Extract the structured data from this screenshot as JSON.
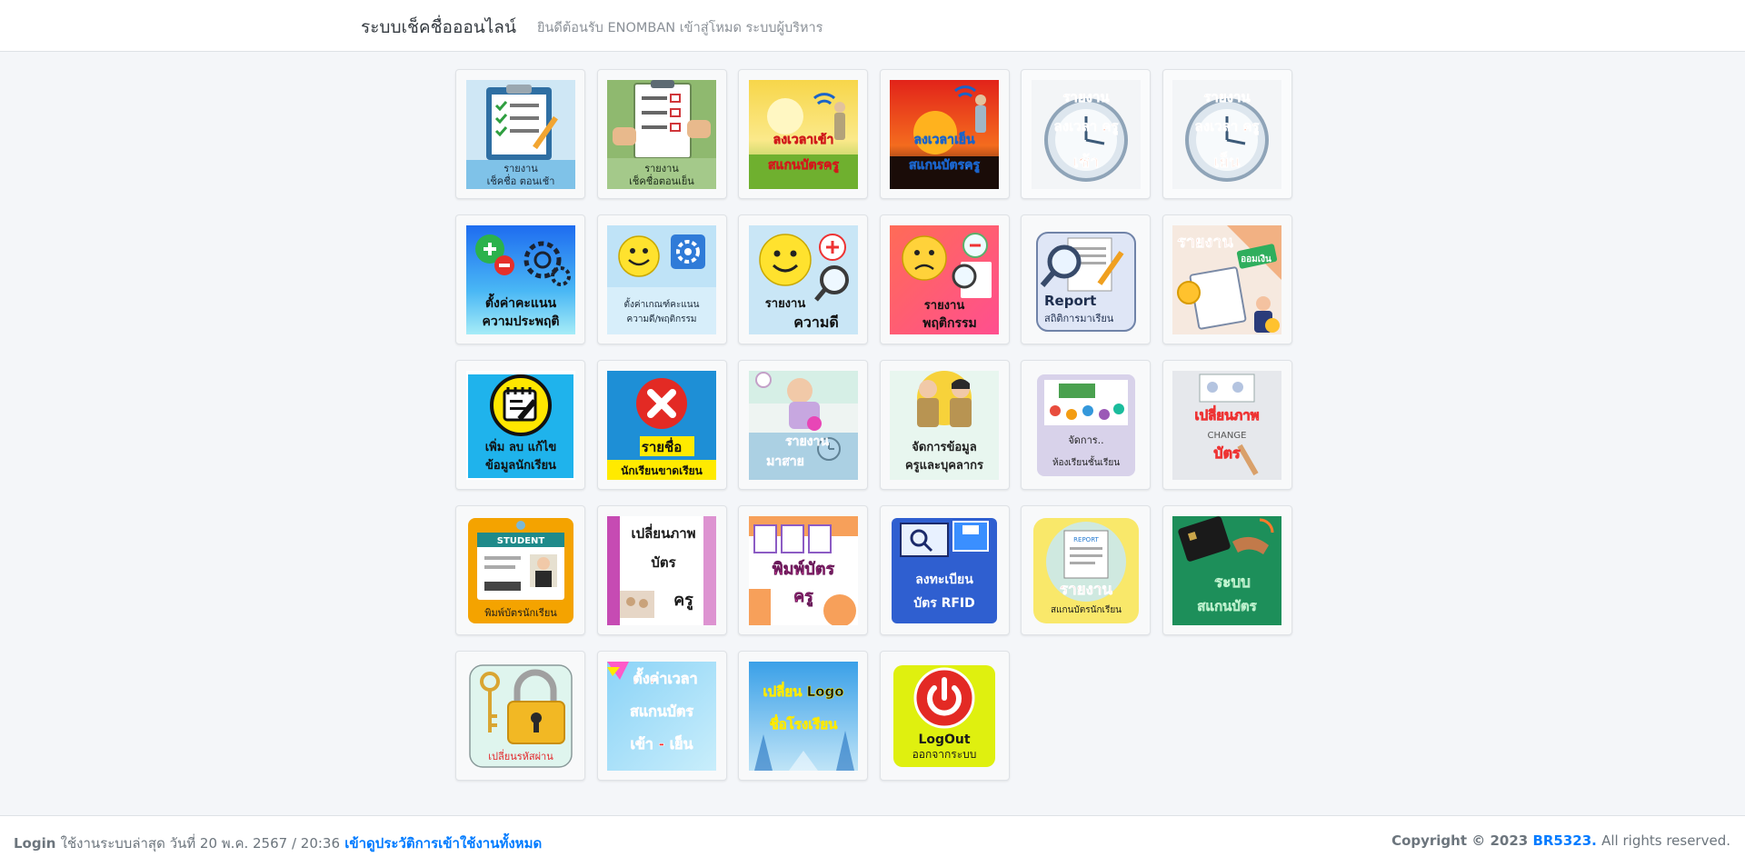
{
  "header": {
    "brand": "ระบบเช็คชื่อออนไลน์",
    "welcome": "ยินดีต้อนรับ ENOMBAN เข้าสู่โหมด ระบบผู้บริหาร"
  },
  "tiles": [
    {
      "icon": "clipboard-checklist-icon",
      "lines": [
        "รายงาน",
        "เช็คชื่อ ตอนเช้า"
      ]
    },
    {
      "icon": "clipboard-checklist-icon",
      "lines": [
        "รายงาน",
        "เช็คชื่อตอนเย็น"
      ]
    },
    {
      "icon": "morning-sun-teacher-icon",
      "lines": [
        "ลงเวลาเข้า",
        "สแกนบัตรครู"
      ]
    },
    {
      "icon": "sunset-teacher-icon",
      "lines": [
        "ลงเวลาเย็น",
        "สแกนบัตรครู"
      ]
    },
    {
      "icon": "clock-report-icon",
      "lines": [
        "รายงาน",
        "ลงเวลา ครู",
        "เช้า"
      ]
    },
    {
      "icon": "clock-report-icon",
      "lines": [
        "รายงาน",
        "ลงเวลา ครู",
        "เย็น"
      ]
    },
    {
      "icon": "gear-plus-minus-icon",
      "lines": [
        "ตั้งค่าคะแนน",
        "ความประพฤติ"
      ]
    },
    {
      "icon": "smiley-gear-icon",
      "lines": [
        "ตั้งค่าเกณฑ์คะแนน",
        "ความดี/พฤติกรรม"
      ]
    },
    {
      "icon": "smiley-magnifier-icon",
      "lines": [
        "รายงาน",
        "ความดี"
      ]
    },
    {
      "icon": "sad-face-magnifier-icon",
      "lines": [
        "รายงาน",
        "พฤติกรรม"
      ]
    },
    {
      "icon": "magnifier-report-icon",
      "lines": [
        "Report",
        "สถิติการมาเรียน"
      ]
    },
    {
      "icon": "money-report-icon",
      "lines": [
        "รายงาน",
        "ออมเงิน"
      ]
    },
    {
      "icon": "notepad-edit-icon",
      "lines": [
        "เพิ่ม ลบ แก้ไข",
        "ข้อมูลนักเรียน"
      ]
    },
    {
      "icon": "red-x-icon",
      "lines": [
        "รายชื่อ",
        "นักเรียนขาดเรียน"
      ]
    },
    {
      "icon": "late-student-icon",
      "lines": [
        "รายงาน",
        "มาสาย"
      ]
    },
    {
      "icon": "teachers-icon",
      "lines": [
        "จัดการข้อมูล",
        "ครูและบุคลากร"
      ]
    },
    {
      "icon": "classroom-icon",
      "lines": [
        "จัดการ..",
        "ห้องเรียนชั้นเรียน"
      ]
    },
    {
      "icon": "change-card-photo-icon",
      "lines": [
        "เปลี่ยนภาพ",
        "CHANGE",
        "บัตร"
      ]
    },
    {
      "icon": "student-card-icon",
      "lines": [
        "STUDENT",
        "พิมพ์บัตรนักเรียน"
      ]
    },
    {
      "icon": "teacher-card-photo-icon",
      "lines": [
        "เปลี่ยนภาพ",
        "บัตร",
        "ครู"
      ]
    },
    {
      "icon": "print-teacher-card-icon",
      "lines": [
        "พิมพ์บัตร",
        "ครู"
      ]
    },
    {
      "icon": "rfid-register-icon",
      "lines": [
        "ลงทะเบียน",
        "บัตร RFID"
      ]
    },
    {
      "icon": "scan-report-icon",
      "lines": [
        "REPORT",
        "รายงาน",
        "สแกนบัตรนักเรียน"
      ]
    },
    {
      "icon": "card-scan-system-icon",
      "lines": [
        "ระบบ",
        "สแกนบัตร"
      ]
    },
    {
      "icon": "padlock-key-icon",
      "lines": [
        "เปลี่ยนรหัสผ่าน"
      ]
    },
    {
      "icon": "time-settings-icon",
      "lines": [
        "ตั้งค่าเวลา",
        "สแกนบัตร",
        "เข้า - เย็น"
      ]
    },
    {
      "icon": "change-logo-icon",
      "lines": [
        "เปลี่ยน Logo",
        "ชื่อโรงเรียน"
      ]
    },
    {
      "icon": "power-logout-icon",
      "lines": [
        "LogOut",
        "ออกจากระบบ"
      ]
    }
  ],
  "colors": {
    "accent": "#007bff",
    "page_bg": "#f4f6f9",
    "muted_text": "#6c757d"
  },
  "footer": {
    "login_prefix": "Login",
    "last_login": "ใช้งานระบบล่าสุด วันที่ 20 พ.ค. 2567 / 20:36",
    "history_link": "เข้าดูประวัติการเข้าใช้งานทั้งหมด",
    "copyright_prefix": "Copyright © 2023",
    "copyright_owner": "BR5323.",
    "rights": "All rights reserved."
  }
}
